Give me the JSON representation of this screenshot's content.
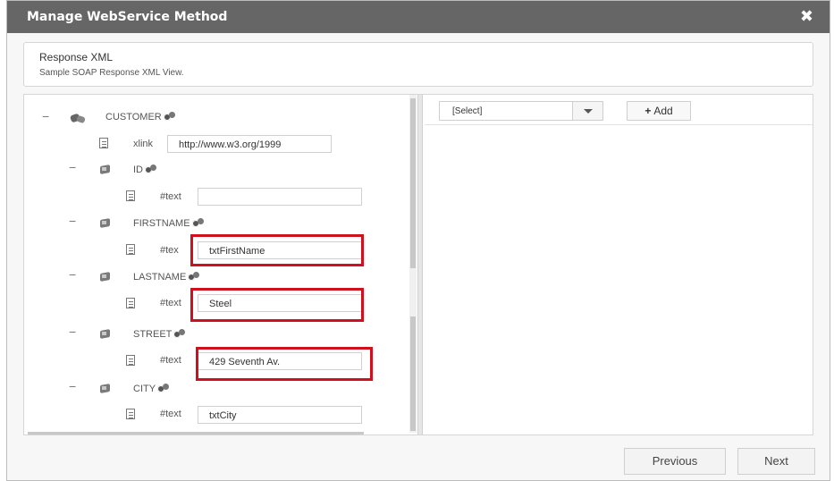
{
  "dialog": {
    "title": "Manage WebService Method",
    "close_label": "✖"
  },
  "info": {
    "heading": "Response XML",
    "subheading": "Sample SOAP Response XML View."
  },
  "tree": {
    "root": {
      "label": "CUSTOMER",
      "collapse": "−"
    },
    "xlink": {
      "label": "xlink",
      "value": "http://www.w3.org/1999"
    },
    "nodes": [
      {
        "label": "ID",
        "collapse": "−",
        "text_label": "#text",
        "value": ""
      },
      {
        "label": "FIRSTNAME",
        "collapse": "−",
        "text_label": "#tex",
        "value": "txtFirstName"
      },
      {
        "label": "LASTNAME",
        "collapse": "−",
        "text_label": "#text",
        "value": "Steel"
      },
      {
        "label": "STREET",
        "collapse": "−",
        "text_label": "#text",
        "value": "429 Seventh Av."
      },
      {
        "label": "CITY",
        "collapse": "−",
        "text_label": "#text",
        "value": "txtCity"
      }
    ]
  },
  "right": {
    "select_value": "[Select]",
    "add_label": "Add",
    "add_icon": "+"
  },
  "footer": {
    "previous_label": "Previous",
    "next_label": "Next"
  },
  "colors": {
    "titlebar": "#666666",
    "highlight": "#d0101c"
  }
}
